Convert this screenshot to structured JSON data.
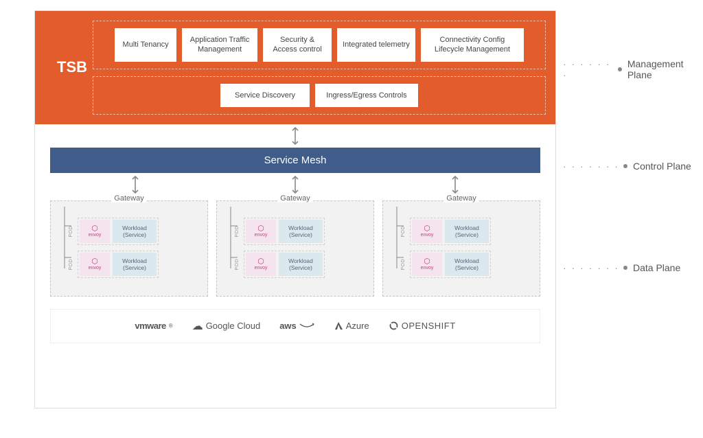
{
  "tsb": {
    "title": "TSB",
    "row1": [
      "Multi Tenancy",
      "Application Traffic Management",
      "Security & Access control",
      "Integrated telemetry",
      "Connectivity Config Lifecycle Management"
    ],
    "row2": [
      "Service Discovery",
      "Ingress/Egress Controls"
    ]
  },
  "service_mesh": {
    "label": "Service Mesh"
  },
  "gateway": {
    "label": "Gateway",
    "pod_label": "POD",
    "envoy": "envoy",
    "workload": "Workload (Service)"
  },
  "vendors": {
    "vmware": "vmware",
    "google": "Google Cloud",
    "aws": "aws",
    "azure": "Azure",
    "openshift": "OPENSHIFT"
  },
  "annotations": {
    "mgmt": "Management Plane",
    "ctrl": "Control Plane",
    "data": "Data Plane"
  }
}
